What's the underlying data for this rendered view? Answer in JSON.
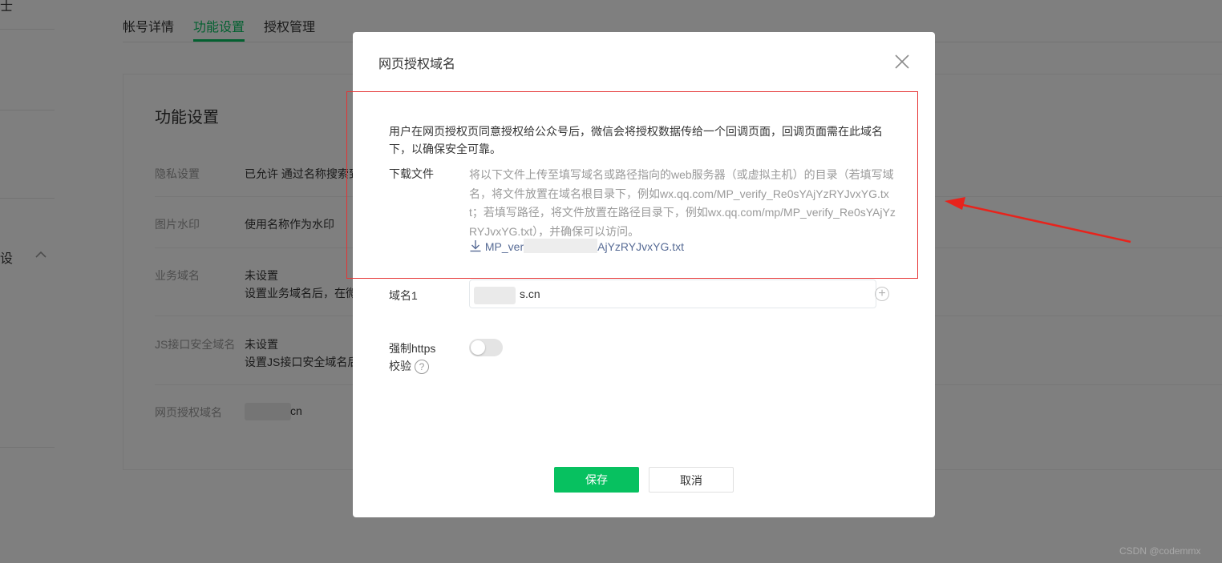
{
  "sidebar": {
    "partial_text_1": "士",
    "partial_text_2": "设",
    "chevron": "chevron-up-icon"
  },
  "tabs": [
    {
      "label": "帐号详情"
    },
    {
      "label": "功能设置"
    },
    {
      "label": "授权管理"
    }
  ],
  "card": {
    "title": "功能设置",
    "rows": [
      {
        "label": "隐私设置",
        "value": "已允许 通过名称搜索到"
      },
      {
        "label": "图片水印",
        "value": "使用名称作为水印"
      },
      {
        "label": "业务域名",
        "value": "未设置",
        "sub": "设置业务域名后，在微"
      },
      {
        "label": "JS接口安全域名",
        "value": "未设置",
        "sub": "设置JS接口安全域名后"
      },
      {
        "label": "网页授权域名",
        "value": "cn"
      }
    ]
  },
  "dialog": {
    "title": "网页授权域名",
    "close_icon": "close-icon",
    "intro": "用户在网页授权页同意授权给公众号后，微信会将授权数据传给一个回调页面，回调页面需在此域名下，以确保安全可靠。",
    "download_label": "下载文件",
    "download_desc": "将以下文件上传至填写域名或路径指向的web服务器（或虚拟主机）的目录（若填写域名，将文件放置在域名根目录下，例如wx.qq.com/MP_verify_Re0sYAjYzRYJvxYG.txt；若填写路径，将文件放置在路径目录下，例如wx.qq.com/mp/MP_verify_Re0sYAjYzRYJvxYG.txt），并确保可以访问。",
    "download_icon": "download-icon",
    "download_link_prefix": "MP_ver",
    "download_link_suffix": "AjYzRYJvxYG.txt",
    "domain_label": "域名1",
    "domain_value": "s.cn",
    "add_icon": "plus-circle-icon",
    "https_label_1": "强制https",
    "https_label_2": "校验",
    "help_icon": "question-icon",
    "https_enabled": false,
    "save_label": "保存",
    "cancel_label": "取消"
  },
  "annotation": {
    "box_color": "#e53333",
    "arrow_color": "#e8231c"
  },
  "watermark": "CSDN @codemmx",
  "colors": {
    "accent": "#07c160",
    "link": "#576b95"
  }
}
